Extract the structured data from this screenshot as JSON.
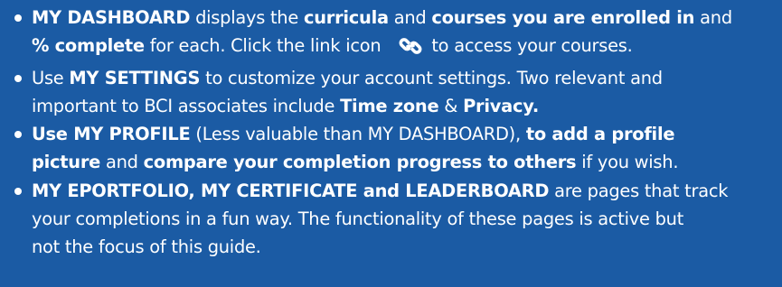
{
  "bullets": [
    {
      "a": "MY DASHBOARD",
      "b": " displays the ",
      "c": "curricula",
      "d": " and ",
      "e": "courses you are enrolled in",
      "f": " and",
      "g": "% complete",
      "h": " for each.  Click the link icon ",
      "i": "to access your courses.",
      "icon": "link-icon"
    },
    {
      "a": "Use ",
      "b": "MY SETTINGS",
      "c": " to customize your account settings.  Two relevant and",
      "d": "important to BCI associates include ",
      "e": "Time zone",
      "f": " & ",
      "g": "Privacy."
    },
    {
      "a": "Use MY PROFILE",
      "b": " (Less valuable than MY DASHBOARD), ",
      "c": "to add a profile",
      "d": "picture",
      "e": " and ",
      "f": "compare your completion progress to others",
      "g": " if you wish."
    },
    {
      "a": "MY EPORTFOLIO, MY CERTIFICATE and LEADERBOARD",
      "b": " are pages that track",
      "c": "your completions in a fun way.  The functionality of these pages is active but",
      "d": "not the focus of this guide."
    }
  ]
}
